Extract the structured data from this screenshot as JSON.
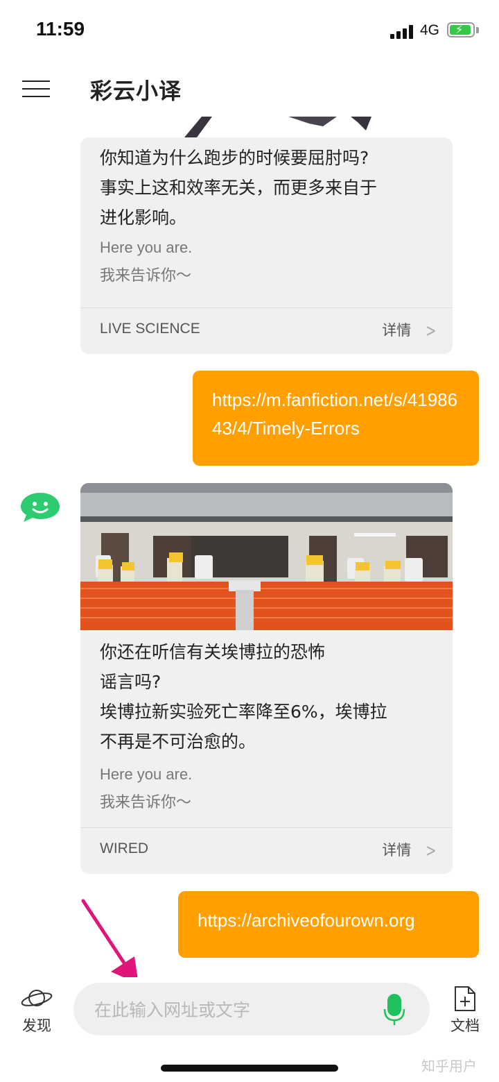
{
  "status_bar": {
    "time": "11:59",
    "network": "4G"
  },
  "header": {
    "title": "彩云小译"
  },
  "messages": {
    "card1": {
      "title": "你知道为什么跑步的时候要屈肘吗?\n事实上这和效率无关，而更多来自于\n进化影响。",
      "sub1": "Here you are.",
      "sub2": "我来告诉你～",
      "source": "LIVE SCIENCE",
      "detail": "详情"
    },
    "user1": {
      "text": "https://m.fanfiction.net/s/4198643/4/Timely-Errors"
    },
    "card2": {
      "title": "你还在听信有关埃博拉的恐怖\n谣言吗?\n埃博拉新实验死亡率降至6%，埃博拉\n不再是不可治愈的。",
      "sub1": "Here you are.",
      "sub2": "我来告诉你～",
      "source": "WIRED",
      "detail": "详情"
    },
    "user2": {
      "text": "https://archiveofourown.org"
    }
  },
  "bottom_bar": {
    "discover_label": "发现",
    "input_placeholder": "在此输入网址或文字",
    "docs_label": "文档",
    "watermark": "知乎用户"
  },
  "colors": {
    "accent": "#ff9f00",
    "bot_green": "#2ecc71",
    "mic_green": "#1fc25a",
    "card_bg": "#f0f0f0",
    "arrow_magenta": "#e0157a"
  },
  "icons": {
    "menu": "hamburger-icon",
    "bot": "chat-bot-avatar-icon",
    "discover": "planet-icon",
    "mic": "microphone-icon",
    "docs": "document-add-icon"
  }
}
